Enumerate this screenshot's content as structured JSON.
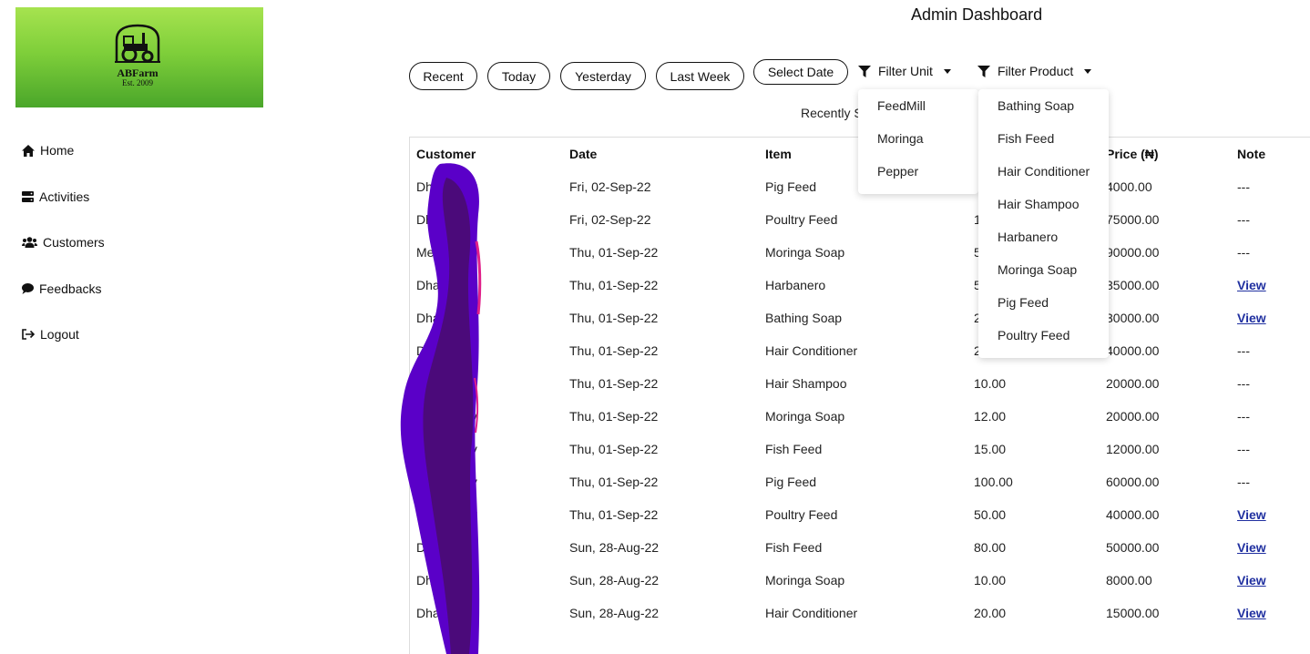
{
  "logo": {
    "brand": "ABFarm",
    "est": "Est. 2009"
  },
  "sidebar": {
    "items": [
      {
        "label": "Home",
        "icon": "home-icon"
      },
      {
        "label": "Activities",
        "icon": "server-icon"
      },
      {
        "label": "Customers",
        "icon": "users-icon"
      },
      {
        "label": "Feedbacks",
        "icon": "comment-icon"
      },
      {
        "label": "Logout",
        "icon": "logout-icon"
      }
    ]
  },
  "header": {
    "title": "Admin Dashboard"
  },
  "filters": {
    "recent": "Recent",
    "today": "Today",
    "yesterday": "Yesterday",
    "last_week": "Last Week",
    "select_date": "Select Date",
    "filter_unit": "Filter Unit",
    "filter_product": "Filter Product"
  },
  "recent_label": "Recently S",
  "unit_menu": [
    "FeedMill",
    "Moringa",
    "Pepper"
  ],
  "product_menu": [
    "Bathing Soap",
    "Fish Feed",
    "Hair Conditioner",
    "Hair Shampoo",
    "Harbanero",
    "Moringa Soap",
    "Pig Feed",
    "Poultry Feed"
  ],
  "table": {
    "headers": [
      "Customer",
      "Date",
      "Item",
      "",
      "Price (₦)",
      "Note"
    ],
    "rows": [
      {
        "customer": "Dhamzeey",
        "date": "Fri, 02-Sep-22",
        "item": "Pig Feed",
        "qty": "",
        "price": "4000.00",
        "note": "---"
      },
      {
        "customer": "Dhamzeey",
        "date": "Fri, 02-Sep-22",
        "item": "Poultry Feed",
        "qty": "1",
        "price": "75000.00",
        "note": "---"
      },
      {
        "customer": "Mercy",
        "date": "Thu, 01-Sep-22",
        "item": "Moringa Soap",
        "qty": "5",
        "price": "90000.00",
        "note": "---"
      },
      {
        "customer": "Dhamzeey",
        "date": "Thu, 01-Sep-22",
        "item": "Harbanero",
        "qty": "5",
        "price": "35000.00",
        "note": "View"
      },
      {
        "customer": "Dhamzeey",
        "date": "Thu, 01-Sep-22",
        "item": "Bathing Soap",
        "qty": "2",
        "price": "30000.00",
        "note": "View"
      },
      {
        "customer": "Dhamzeey",
        "date": "Thu, 01-Sep-22",
        "item": "Hair Conditioner",
        "qty": "2",
        "price": "40000.00",
        "note": "---"
      },
      {
        "customer": "Dhamzeey",
        "date": "Thu, 01-Sep-22",
        "item": "Hair Shampoo",
        "qty": "10.00",
        "price": "20000.00",
        "note": "---"
      },
      {
        "customer": "Dhamzeey",
        "date": "Thu, 01-Sep-22",
        "item": "Moringa Soap",
        "qty": "12.00",
        "price": "20000.00",
        "note": "---"
      },
      {
        "customer": "Dhamzeey",
        "date": "Thu, 01-Sep-22",
        "item": "Fish Feed",
        "qty": "15.00",
        "price": "12000.00",
        "note": "---"
      },
      {
        "customer": "Dhamzeey",
        "date": "Thu, 01-Sep-22",
        "item": "Pig Feed",
        "qty": "100.00",
        "price": "60000.00",
        "note": "---"
      },
      {
        "customer": "Dhamzeey",
        "date": "Thu, 01-Sep-22",
        "item": "Poultry Feed",
        "qty": "50.00",
        "price": "40000.00",
        "note": "View"
      },
      {
        "customer": "Dhamzeey",
        "date": "Sun, 28-Aug-22",
        "item": "Fish Feed",
        "qty": "80.00",
        "price": "50000.00",
        "note": "View"
      },
      {
        "customer": "Dhamzeey",
        "date": "Sun, 28-Aug-22",
        "item": "Moringa Soap",
        "qty": "10.00",
        "price": "8000.00",
        "note": "View"
      },
      {
        "customer": "Dhamzeey",
        "date": "Sun, 28-Aug-22",
        "item": "Hair Conditioner",
        "qty": "20.00",
        "price": "15000.00",
        "note": "View"
      }
    ]
  },
  "colors": {
    "logo_green": "#6cc03a",
    "link": "#2030a0",
    "scribble_purple": "#5a00c8",
    "scribble_dark": "#4b0a7a"
  }
}
